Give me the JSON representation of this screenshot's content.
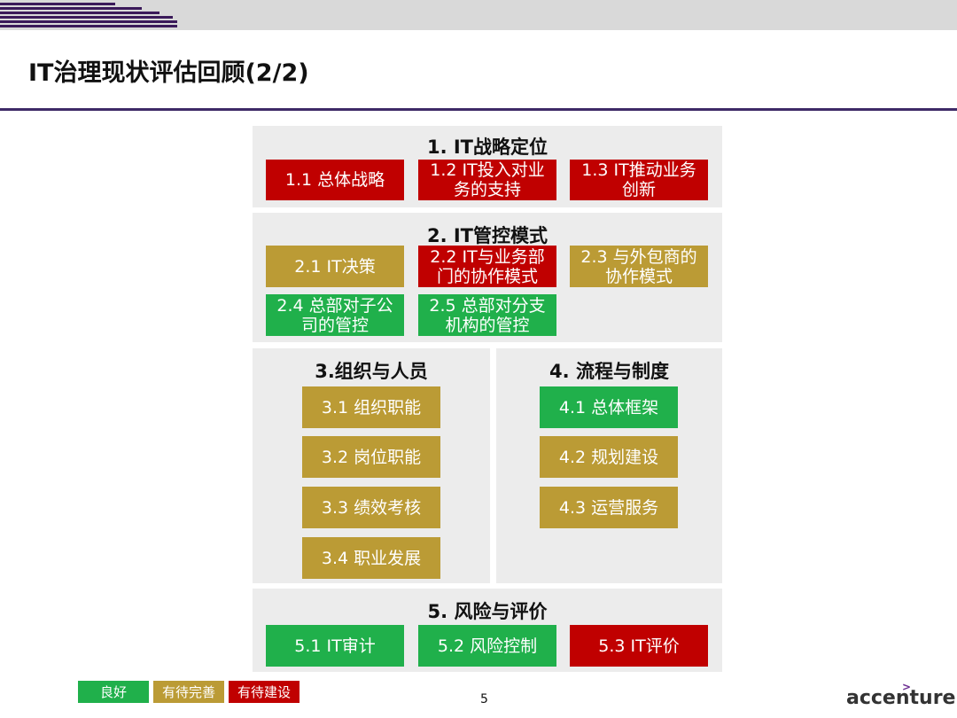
{
  "header": {
    "title": "IT治理现状评估回顾(2/2)"
  },
  "sections": {
    "s1": {
      "title": "1. IT战略定位",
      "items": [
        {
          "label": "1.1 总体战略",
          "status": "red"
        },
        {
          "label": "1.2 IT投入对业\n务的支持",
          "status": "red"
        },
        {
          "label": "1.3 IT推动业务\n创新",
          "status": "red"
        }
      ]
    },
    "s2": {
      "title": "2. IT管控模式",
      "items": [
        {
          "label": "2.1 IT决策",
          "status": "amber"
        },
        {
          "label": "2.2 IT与业务部\n门的协作模式",
          "status": "red"
        },
        {
          "label": "2.3 与外包商的\n协作模式",
          "status": "amber"
        },
        {
          "label": "2.4 总部对子公\n司的管控",
          "status": "green"
        },
        {
          "label": "2.5 总部对分支\n机构的管控",
          "status": "green"
        }
      ]
    },
    "s3": {
      "title": "3.组织与人员",
      "items": [
        {
          "label": "3.1 组织职能",
          "status": "amber"
        },
        {
          "label": "3.2 岗位职能",
          "status": "amber"
        },
        {
          "label": "3.3 绩效考核",
          "status": "amber"
        },
        {
          "label": "3.4 职业发展",
          "status": "amber"
        }
      ]
    },
    "s4": {
      "title": "4. 流程与制度",
      "items": [
        {
          "label": "4.1 总体框架",
          "status": "green"
        },
        {
          "label": "4.2 规划建设",
          "status": "amber"
        },
        {
          "label": "4.3 运营服务",
          "status": "amber"
        }
      ]
    },
    "s5": {
      "title": "5. 风险与评价",
      "items": [
        {
          "label": "5.1 IT审计",
          "status": "green"
        },
        {
          "label": "5.2 风险控制",
          "status": "green"
        },
        {
          "label": "5.3 IT评价",
          "status": "red"
        }
      ]
    }
  },
  "legend": [
    {
      "label": "良好",
      "color": "#20b04b"
    },
    {
      "label": "有待完善",
      "color": "#bb9b35"
    },
    {
      "label": "有待建设",
      "color": "#c00000"
    }
  ],
  "footer": {
    "page": "5",
    "logo": "accenture"
  },
  "colors": {
    "red": "#c00000",
    "amber": "#bb9b35",
    "green": "#20b04b",
    "accent": "#3e2a67"
  }
}
